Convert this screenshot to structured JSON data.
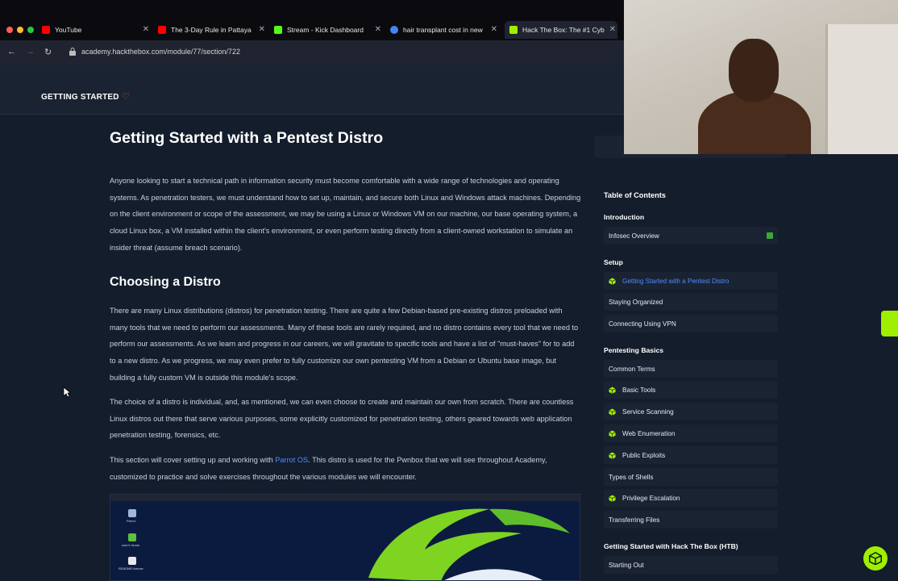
{
  "browser": {
    "tabs": [
      {
        "label": "YouTube",
        "favicon_color": "#ff0000"
      },
      {
        "label": "The 3-Day Rule in Pattaya",
        "favicon_color": "#ff0000"
      },
      {
        "label": "Stream - Kick Dashboard",
        "favicon_color": "#53fc18"
      },
      {
        "label": "hair transplant cost in new",
        "favicon_color": "#4285f4"
      },
      {
        "label": "Hack The Box: The #1 Cyb",
        "favicon_color": "#9fef00"
      }
    ],
    "url": "academy.hackthebox.com/module/77/section/722"
  },
  "module_header": {
    "title": "GETTING STARTED",
    "favorite_icon": "heart-icon"
  },
  "main": {
    "title": "Getting Started with a Pentest Distro",
    "intro_paragraph": "Anyone looking to start a technical path in information security must become comfortable with a wide range of technologies and operating systems. As penetration testers, we must understand how to set up, maintain, and secure both Linux and Windows attack machines. Depending on the client environment or scope of the assessment, we may be using a Linux or Windows VM on our machine, our base operating system, a cloud Linux box, a VM installed within the client's environment, or even perform testing directly from a client-owned workstation to simulate an insider threat (assume breach scenario).",
    "section_heading": "Choosing a Distro",
    "paragraph_2": "There are many Linux distributions (distros) for penetration testing. There are quite a few Debian-based pre-existing distros preloaded with many tools that we need to perform our assessments. Many of these tools are rarely required, and no distro contains every tool that we need to perform our assessments. As we learn and progress in our careers, we will gravitate to specific tools and have a list of \"must-haves\" for to add to a new distro. As we progress, we may even prefer to fully customize our own pentesting VM from a Debian or Ubuntu base image, but building a fully custom VM is outside this module's scope.",
    "paragraph_3": "The choice of a distro is individual, and, as mentioned, we can even choose to create and maintain our own from scratch. There are countless Linux distros out there that serve various purposes, some explicitly customized for penetration testing, others geared towards web application penetration testing, forensics, etc.",
    "paragraph_4_before": "This section will cover setting up and working with ",
    "paragraph_4_link": "Parrot OS",
    "paragraph_4_after": ". This distro is used for the Pwnbox that we will see throughout Academy, customized to practice and solve exercises throughout the various modules we will encounter.",
    "screenshot_desktop_labels": [
      "Parrot",
      "user's Home",
      "README.license"
    ]
  },
  "sidebar": {
    "toc_heading": "Table of Contents",
    "groups": [
      {
        "label": "Introduction",
        "items": [
          {
            "label": "Infosec Overview",
            "cube": false,
            "completed": true,
            "active": false
          }
        ]
      },
      {
        "label": "Setup",
        "items": [
          {
            "label": "Getting Started with a Pentest Distro",
            "cube": true,
            "completed": false,
            "active": true
          },
          {
            "label": "Staying Organized",
            "cube": false,
            "completed": false,
            "active": false
          },
          {
            "label": "Connecting Using VPN",
            "cube": false,
            "completed": false,
            "active": false
          }
        ]
      },
      {
        "label": "Pentesting Basics",
        "items": [
          {
            "label": "Common Terms",
            "cube": false,
            "completed": false,
            "active": false
          },
          {
            "label": "Basic Tools",
            "cube": true,
            "completed": false,
            "active": false
          },
          {
            "label": "Service Scanning",
            "cube": true,
            "completed": false,
            "active": false
          },
          {
            "label": "Web Enumeration",
            "cube": true,
            "completed": false,
            "active": false
          },
          {
            "label": "Public Exploits",
            "cube": true,
            "completed": false,
            "active": false
          },
          {
            "label": "Types of Shells",
            "cube": false,
            "completed": false,
            "active": false
          },
          {
            "label": "Privilege Escalation",
            "cube": true,
            "completed": false,
            "active": false
          },
          {
            "label": "Transferring Files",
            "cube": false,
            "completed": false,
            "active": false
          }
        ]
      },
      {
        "label": "Getting Started with Hack The Box (HTB)",
        "items": [
          {
            "label": "Starting Out",
            "cube": false,
            "completed": false,
            "active": false
          }
        ]
      }
    ]
  },
  "colors": {
    "background": "#141d2b",
    "accent_green": "#9fef00",
    "link_blue": "#4e8dff",
    "heart_red": "#ff3e3e"
  }
}
